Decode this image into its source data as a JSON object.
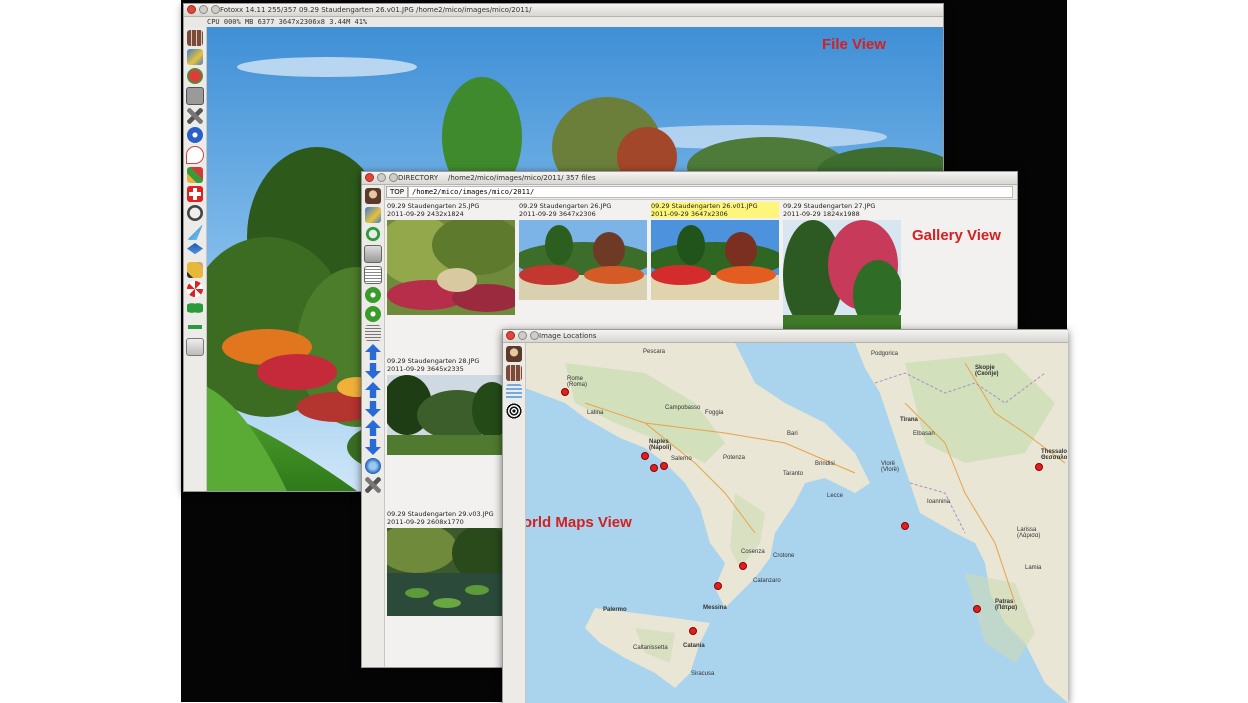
{
  "labels": {
    "file_view": "File View",
    "gallery_view": "Gallery View",
    "maps_view": "World Maps View"
  },
  "main_window": {
    "title": "Fotoxx 14.11  255/357  09.29 Staudengarten 26.v01.JPG  /home2/mico/images/mico/2011/",
    "status": "CPU 000% MB 6377  3647x2306x8  3.44M  41%",
    "tool_icons": [
      "grid-icon",
      "mosaic-icon",
      "heart-icon",
      "file-icon",
      "tools-icon",
      "info-icon",
      "drop-icon",
      "brush-icon",
      "redcross-icon",
      "mask-icon",
      "bird-icon",
      "layers-icon",
      "pencil-icon",
      "lifebuoy-icon",
      "wave-icon",
      "arrows-icon",
      "download-icon"
    ]
  },
  "gallery_window": {
    "title_label": "DIRECTORY",
    "title_path": "/home2/mico/images/mico/2011/  357 files",
    "top_button": "TOP",
    "path": "/home2/mico/images/mico/2011/",
    "thumbs": [
      {
        "name": "09.29 Staudengarten 25.JPG",
        "info": "2011-09-29  2432x1824",
        "selected": false
      },
      {
        "name": "09.29 Staudengarten 26.JPG",
        "info": "2011-09-29  3647x2306",
        "selected": false
      },
      {
        "name": "09.29 Staudengarten 26.v01.JPG",
        "info": "2011-09-29  3647x2306",
        "selected": true
      },
      {
        "name": "09.29 Staudengarten 27.JPG",
        "info": "2011-09-29  1824x1988",
        "selected": false
      },
      {
        "name": "09.29 Staudengarten 28.JPG",
        "info": "2011-09-29  3645x2335",
        "selected": false
      },
      {
        "name": "09.29 Staudengarten 29.v03.JPG",
        "info": "2011-09-29  2608x1770",
        "selected": false
      }
    ]
  },
  "maps_window": {
    "title": "Image Locations",
    "cities": [
      {
        "name": "Pescara"
      },
      {
        "name": "Rome\n(Roma)"
      },
      {
        "name": "Latina"
      },
      {
        "name": "Campobasso"
      },
      {
        "name": "Foggia"
      },
      {
        "name": "Bari"
      },
      {
        "name": "Naples\n(Napoli)"
      },
      {
        "name": "Salerno"
      },
      {
        "name": "Potenza"
      },
      {
        "name": "Taranto"
      },
      {
        "name": "Brindisi"
      },
      {
        "name": "Lecce"
      },
      {
        "name": "Cosenza"
      },
      {
        "name": "Crotone"
      },
      {
        "name": "Catanzaro"
      },
      {
        "name": "Palermo"
      },
      {
        "name": "Messina"
      },
      {
        "name": "Catania"
      },
      {
        "name": "Siracusa"
      },
      {
        "name": "Caltanissetta"
      },
      {
        "name": "Podgorica"
      },
      {
        "name": "Skopje\n(Скопје)"
      },
      {
        "name": "Tirana"
      },
      {
        "name": "Elbasan"
      },
      {
        "name": "Vlorë\n(Vlorë)"
      },
      {
        "name": "Thessalo\nΘεσσαλο"
      },
      {
        "name": "Larissa\n(Λάρισα)"
      },
      {
        "name": "Patras\n(Πάτρα)"
      },
      {
        "name": "Lamia"
      },
      {
        "name": "Ioannina"
      }
    ]
  }
}
